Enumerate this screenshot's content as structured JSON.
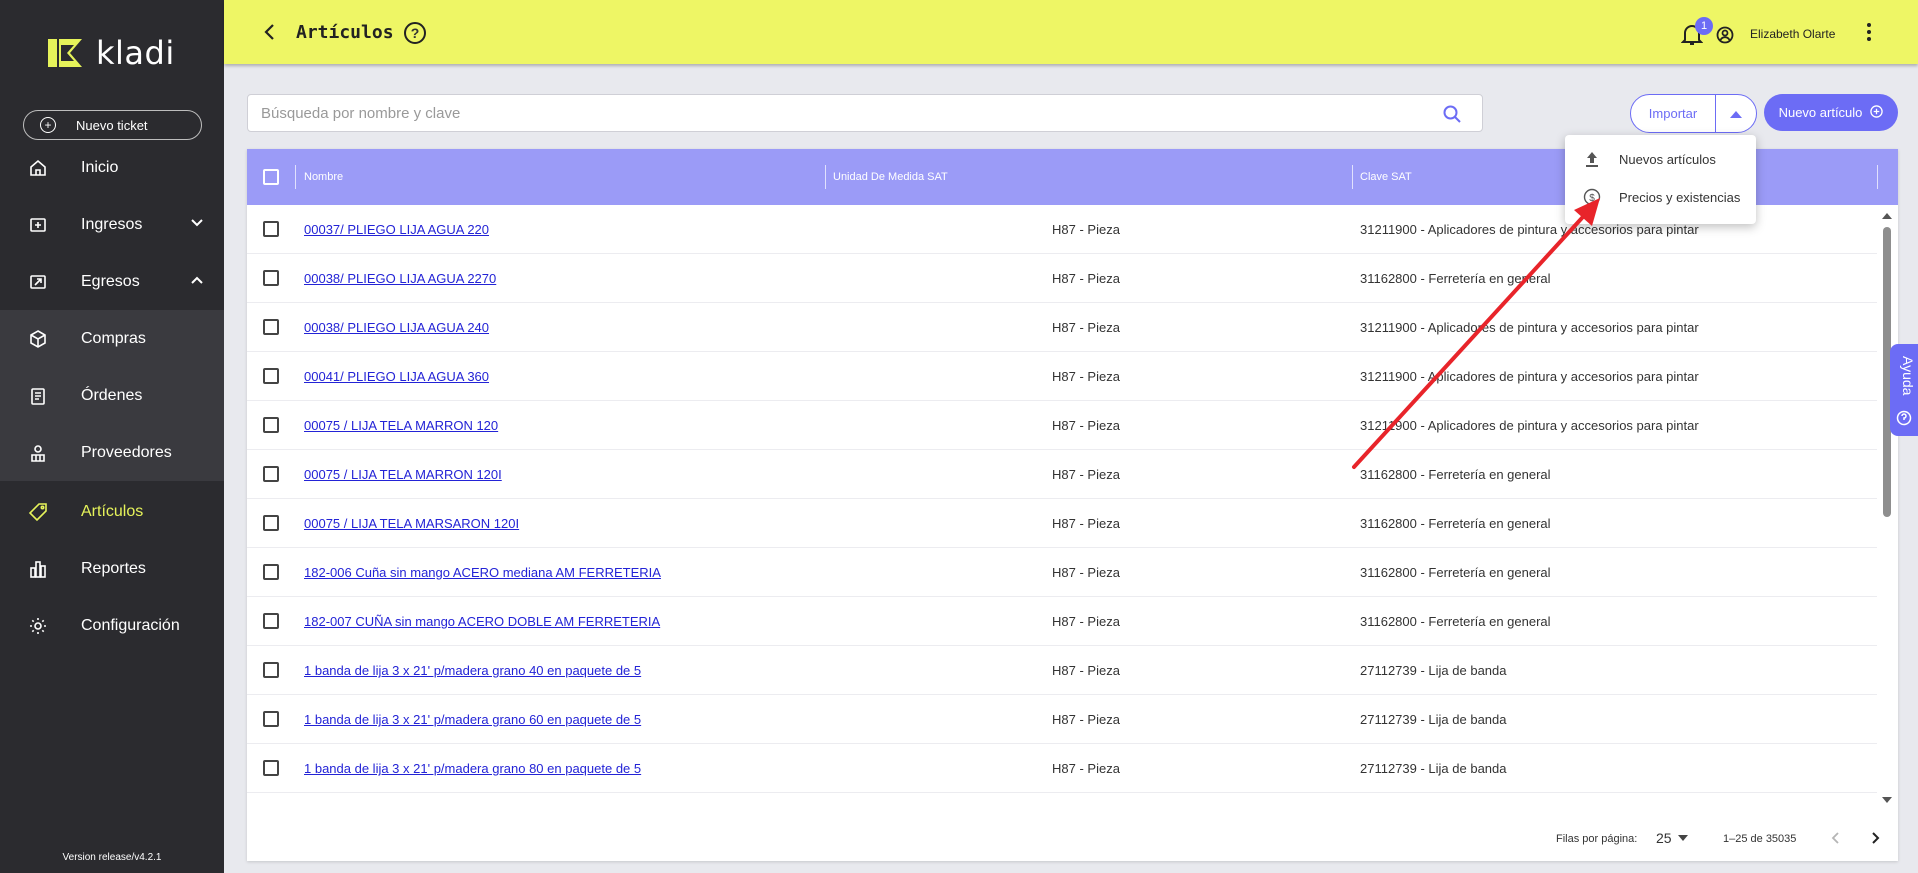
{
  "app": {
    "brand": "kladi",
    "version": "Version release/v4.2.1"
  },
  "sidebar": {
    "new_ticket": "Nuevo ticket",
    "items": [
      {
        "label": "Inicio",
        "icon": "home-icon"
      },
      {
        "label": "Ingresos",
        "icon": "income-icon"
      },
      {
        "label": "Egresos",
        "icon": "expense-icon"
      },
      {
        "label": "Compras",
        "icon": "box-icon"
      },
      {
        "label": "Órdenes",
        "icon": "clipboard-icon"
      },
      {
        "label": "Proveedores",
        "icon": "supplier-icon"
      },
      {
        "label": "Artículos",
        "icon": "tag-icon"
      },
      {
        "label": "Reportes",
        "icon": "bar-chart-icon"
      },
      {
        "label": "Configuración",
        "icon": "gear-icon"
      }
    ]
  },
  "topbar": {
    "title": "Artículos",
    "notifications_count": "1",
    "user_name": "Elizabeth Olarte"
  },
  "search": {
    "placeholder": "Búsqueda por nombre y clave",
    "value": ""
  },
  "actions": {
    "import_label": "Importar",
    "new_article_label": "Nuevo artículo"
  },
  "import_menu": {
    "items": [
      {
        "label": "Nuevos artículos",
        "icon": "upload-icon"
      },
      {
        "label": "Precios y existencias",
        "icon": "dollar-circle-icon"
      }
    ]
  },
  "table": {
    "columns": [
      "Nombre",
      "Unidad De Medida SAT",
      "Clave SAT"
    ],
    "rows": [
      {
        "name": "00037/ PLIEGO LIJA AGUA 220",
        "unit": "H87 - Pieza",
        "clave": "31211900 - Aplicadores de pintura y accesorios para pintar"
      },
      {
        "name": "00038/ PLIEGO LIJA AGUA 2270",
        "unit": "H87 - Pieza",
        "clave": "31162800 - Ferretería en general"
      },
      {
        "name": "00038/ PLIEGO LIJA AGUA 240",
        "unit": "H87 - Pieza",
        "clave": "31211900 - Aplicadores de pintura y accesorios para pintar"
      },
      {
        "name": "00041/ PLIEGO LIJA AGUA 360",
        "unit": "H87 - Pieza",
        "clave": "31211900 - Aplicadores de pintura y accesorios para pintar"
      },
      {
        "name": "00075 / LIJA TELA MARRON 120",
        "unit": "H87 - Pieza",
        "clave": "31211900 - Aplicadores de pintura y accesorios para pintar"
      },
      {
        "name": "00075 / LIJA TELA MARRON 120I",
        "unit": "H87 - Pieza",
        "clave": "31162800 - Ferretería en general"
      },
      {
        "name": "00075 / LIJA TELA MARSARON 120I",
        "unit": "H87 - Pieza",
        "clave": "31162800 - Ferretería en general"
      },
      {
        "name": "182-006 Cuña sin mango ACERO mediana AM FERRETERIA",
        "unit": "H87 - Pieza",
        "clave": "31162800 - Ferretería en general"
      },
      {
        "name": "182-007 CUÑA sin mango ACERO DOBLE AM FERRETERIA",
        "unit": "H87 - Pieza",
        "clave": "31162800 - Ferretería en general"
      },
      {
        "name": "1 banda de lija 3 x 21' p/madera grano 40 en paquete de 5",
        "unit": "H87 - Pieza",
        "clave": "27112739 - Lija de banda"
      },
      {
        "name": "1 banda de lija 3 x 21' p/madera grano 60 en paquete de 5",
        "unit": "H87 - Pieza",
        "clave": "27112739 - Lija de banda"
      },
      {
        "name": "1 banda de lija 3 x 21' p/madera grano 80 en paquete de 5",
        "unit": "H87 - Pieza",
        "clave": "27112739 - Lija de banda"
      }
    ]
  },
  "pagination": {
    "rows_label": "Filas por página:",
    "rows_per_page": "25",
    "range": "1–25 de 35035"
  },
  "help_tab": {
    "label": "Ayuda"
  },
  "colors": {
    "accent": "#6c6cf5",
    "topbar": "#eef665",
    "sidebar": "#2b2b2f",
    "annotation_arrow": "#e8242a"
  }
}
